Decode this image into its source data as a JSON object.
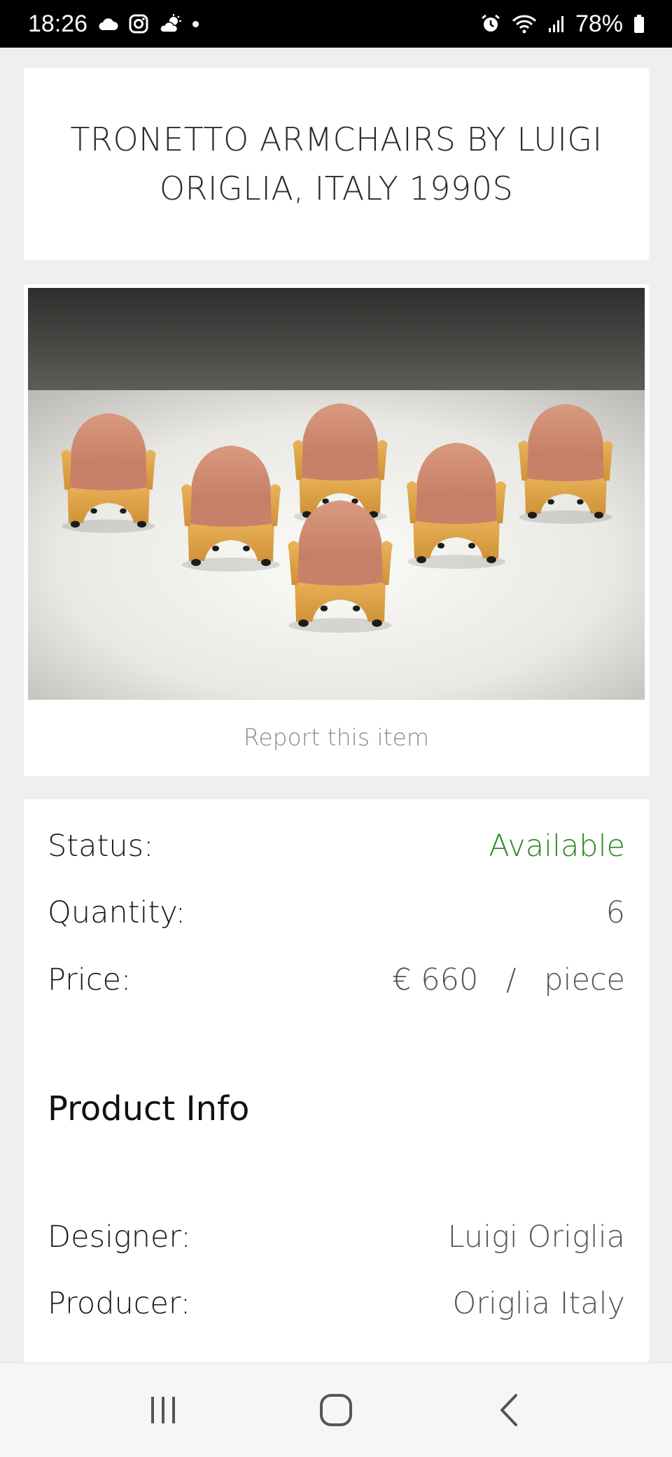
{
  "status_bar": {
    "time": "18:26",
    "battery": "78%",
    "left_icons": [
      "cloud-icon",
      "instagram-icon",
      "weather-icon",
      "dot-icon"
    ],
    "right_icons": [
      "alarm-icon",
      "wifi-icon",
      "signal-icon",
      "battery-icon"
    ]
  },
  "title": "TRONETTO ARMCHAIRS BY LUIGI ORIGLIA, ITALY 1990S",
  "image": {
    "report_link": "Report this item"
  },
  "details": {
    "status_label": "Status:",
    "status_value": "Available",
    "quantity_label": "Quantity:",
    "quantity_value": "6",
    "price_label": "Price:",
    "price_amount": "€ 660",
    "price_sep": "/",
    "price_unit": "piece"
  },
  "product_info": {
    "heading": "Product Info",
    "designer_label": "Designer:",
    "designer_value": "Luigi Origlia",
    "producer_label": "Producer:",
    "producer_value": "Origlia Italy"
  },
  "colors": {
    "available": "#2a8a1f",
    "chair_upholstery": "#d08a70",
    "chair_frame": "#e0a84e"
  },
  "nav_bar": {
    "buttons": [
      "recent-apps-icon",
      "home-icon",
      "back-icon"
    ]
  }
}
